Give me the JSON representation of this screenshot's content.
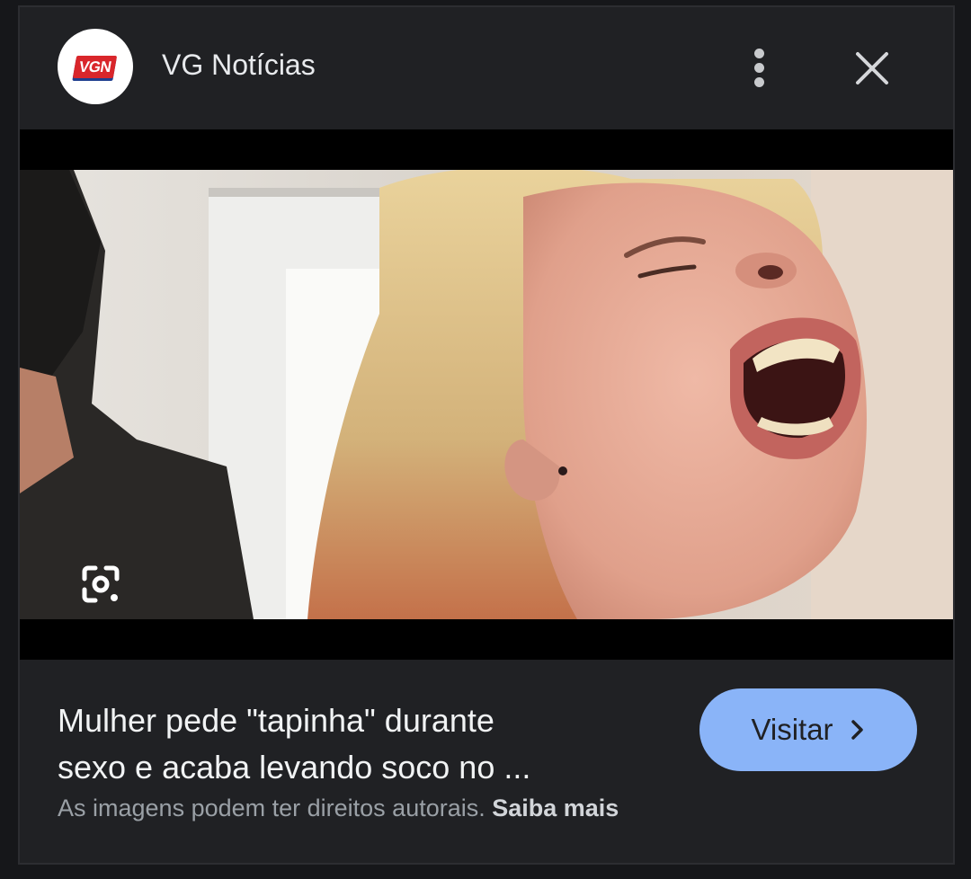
{
  "header": {
    "logo_text": "VGN",
    "site_name": "VG Notícias",
    "menu_icon": "more-vert-icon",
    "close_icon": "close-icon"
  },
  "image": {
    "lens_icon": "google-lens-icon"
  },
  "article": {
    "headline_line1": "Mulher pede \"tapinha\" durante",
    "headline_line2": "sexo e acaba levando soco no ...",
    "visit_label": "Visitar",
    "visit_icon": "chevron-right-icon",
    "copyright_text": "As imagens podem ter direitos autorais.",
    "learn_more": "Saiba mais"
  },
  "colors": {
    "background": "#202124",
    "accent": "#8ab4f8",
    "logo_red": "#d9262b",
    "logo_blue": "#1f3f8f"
  }
}
